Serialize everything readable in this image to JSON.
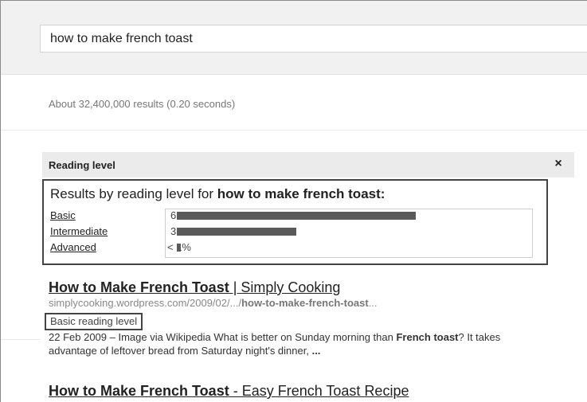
{
  "search": {
    "query": "how to make french toast"
  },
  "stats": {
    "text": "About 32,400,000 results (0.20 seconds)"
  },
  "reading_panel": {
    "title": "Reading level",
    "close_glyph": "×",
    "heading_prefix": "Results by reading level for ",
    "heading_query": "how to make french toast:",
    "levels": [
      {
        "label": "Basic",
        "percent_text": "66%",
        "fraction": 0.66
      },
      {
        "label": "Intermediate",
        "percent_text": "33%",
        "fraction": 0.33
      },
      {
        "label": "Advanced",
        "percent_text": "< 1%",
        "fraction": 0.01
      }
    ]
  },
  "results": [
    {
      "title_bold": "How to Make French Toast",
      "title_rest": " | Simply Cooking",
      "url_plain": "simplycooking.wordpress.com/2009/02/.../",
      "url_bold": "how-to-make-french-toast",
      "url_tail": "...",
      "reading_badge": "Basic reading level",
      "snippet_parts": [
        {
          "text": "22 Feb 2009 – Image via Wikipedia What is better on Sunday morning than ",
          "bold": false
        },
        {
          "text": "French toast",
          "bold": true
        },
        {
          "text": "? It takes advantage of leftover bread from Saturday night's dinner, ",
          "bold": false
        },
        {
          "text": "...",
          "bold": true
        }
      ]
    },
    {
      "title_bold": "How to Make French Toast",
      "title_rest": " - Easy French Toast Recipe"
    }
  ]
}
